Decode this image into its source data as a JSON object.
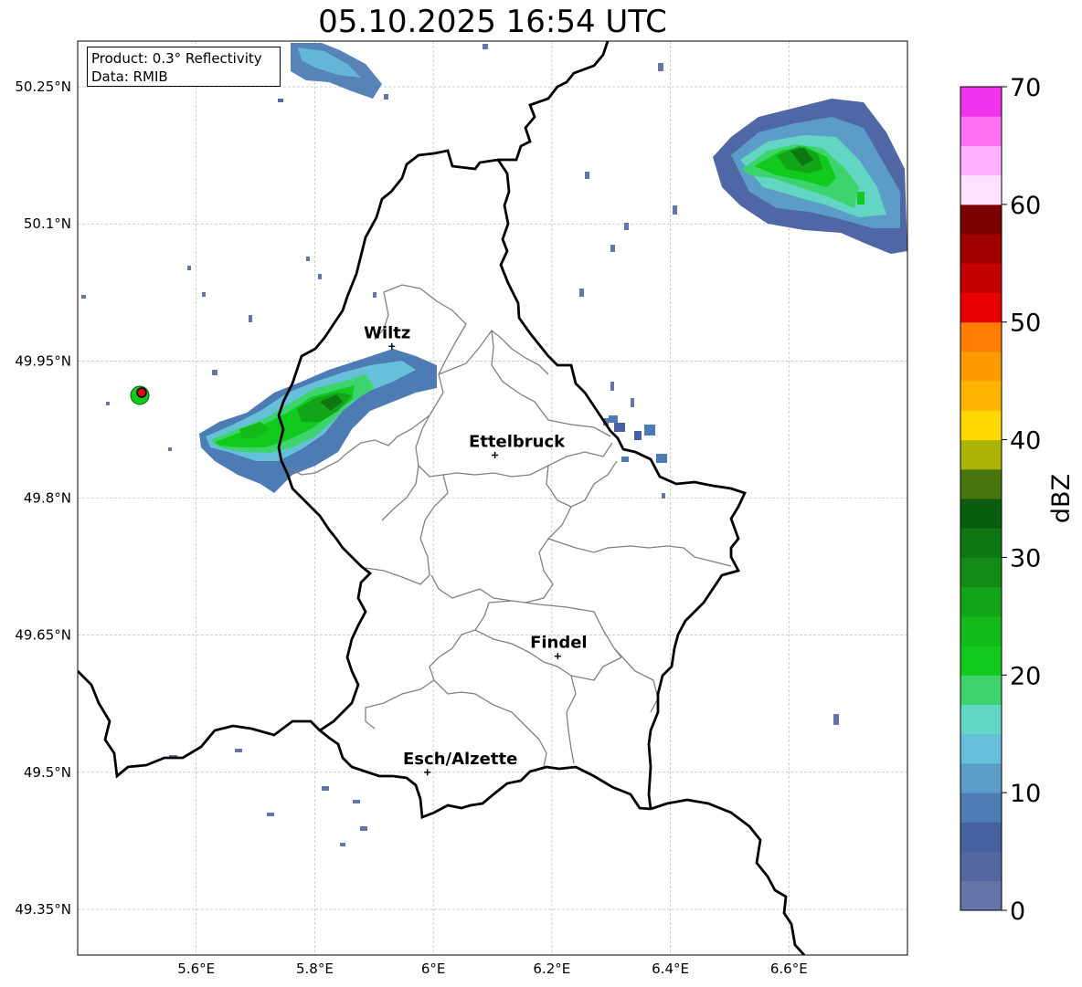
{
  "title": "05.10.2025 16:54 UTC",
  "info": {
    "product": "Product: 0.3° Reflectivity",
    "source": "Data: RMIB"
  },
  "map": {
    "lon_range": [
      5.4,
      6.8
    ],
    "lat_range": [
      49.3,
      50.3
    ],
    "lat_ticks": [
      {
        "value": 50.25,
        "label": "50.25°N"
      },
      {
        "value": 50.1,
        "label": "50.1°N"
      },
      {
        "value": 49.95,
        "label": "49.95°N"
      },
      {
        "value": 49.8,
        "label": "49.8°N"
      },
      {
        "value": 49.65,
        "label": "49.65°N"
      },
      {
        "value": 49.5,
        "label": "49.5°N"
      },
      {
        "value": 49.35,
        "label": "49.35°N"
      }
    ],
    "lon_ticks": [
      {
        "value": 5.6,
        "label": "5.6°E"
      },
      {
        "value": 5.8,
        "label": "5.8°E"
      },
      {
        "value": 6.0,
        "label": "6°E"
      },
      {
        "value": 6.2,
        "label": "6.2°E"
      },
      {
        "value": 6.4,
        "label": "6.4°E"
      },
      {
        "value": 6.6,
        "label": "6.6°E"
      }
    ],
    "grid": true,
    "cities": [
      {
        "name": "Wiltz",
        "lon": 5.93,
        "lat": 49.966
      },
      {
        "name": "Ettelbruck",
        "lon": 6.104,
        "lat": 49.847
      },
      {
        "name": "Findel",
        "lon": 6.21,
        "lat": 49.627
      },
      {
        "name": "Esch/Alzette",
        "lon": 5.99,
        "lat": 49.5
      }
    ],
    "radar_site": {
      "lon": 5.505,
      "lat": 49.914
    }
  },
  "colorbar": {
    "label": "dBZ",
    "min": 0,
    "max": 70,
    "step": 2.5,
    "tick_labels": [
      "0",
      "10",
      "20",
      "30",
      "40",
      "50",
      "60",
      "70"
    ],
    "colors": [
      "#6675a8",
      "#54679e",
      "#4660a0",
      "#4d7cb4",
      "#5b9dc8",
      "#66c0da",
      "#62d6c2",
      "#3dd46e",
      "#12c91e",
      "#14b91a",
      "#13a518",
      "#128a15",
      "#0f7712",
      "#0a5c0f",
      "#487510",
      "#aab508",
      "#ffd800",
      "#ffb500",
      "#ff9a00",
      "#ff7d00",
      "#e80000",
      "#c50000",
      "#a20000",
      "#7d0000",
      "#ffe0ff",
      "#ffb1ff",
      "#ff70f3",
      "#ee35ed"
    ]
  }
}
